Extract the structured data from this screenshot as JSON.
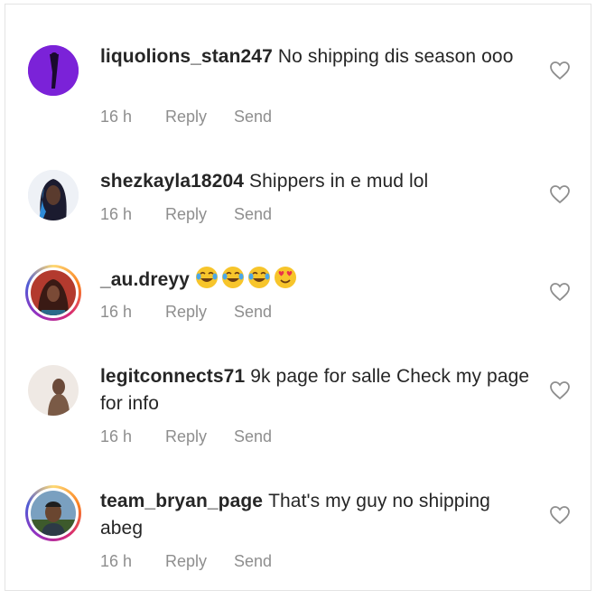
{
  "comments": [
    {
      "username": "liquolions_stan247",
      "text": "No shipping dis season ooo",
      "time": "16 h",
      "reply_label": "Reply",
      "send_label": "Send",
      "avatar_colors": [
        "#8e2de2",
        "#2b1055"
      ],
      "story_ring": false
    },
    {
      "username": "shezkayla18204",
      "text": "Shippers in e mud lol",
      "time": "16 h",
      "reply_label": "Reply",
      "send_label": "Send",
      "avatar_colors": [
        "#e8edf5",
        "#1b1b2f"
      ],
      "story_ring": false
    },
    {
      "username": "_au.dreyy",
      "text": "",
      "emojis": [
        "tears-of-joy-emoji",
        "tears-of-joy-emoji",
        "tears-of-joy-emoji",
        "heart-eyes-emoji"
      ],
      "time": "16 h",
      "reply_label": "Reply",
      "send_label": "Send",
      "avatar_colors": [
        "#b33a2e",
        "#3a1a14"
      ],
      "story_ring": true
    },
    {
      "username": "legitconnects71",
      "text": "9k page for salle Check my page for info",
      "time": "16 h",
      "reply_label": "Reply",
      "send_label": "Send",
      "avatar_colors": [
        "#ece6e1",
        "#6b4a3a"
      ],
      "story_ring": false
    },
    {
      "username": "team_bryan_page",
      "text": "That's my guy no shipping abeg",
      "time": "16 h",
      "reply_label": "Reply",
      "send_label": "Send",
      "avatar_colors": [
        "#6c8fb0",
        "#2f3c2a"
      ],
      "story_ring": true
    }
  ],
  "colors": {
    "text": "#262626",
    "meta": "#8e8e8e",
    "heart_stroke": "#8e8e8e"
  }
}
